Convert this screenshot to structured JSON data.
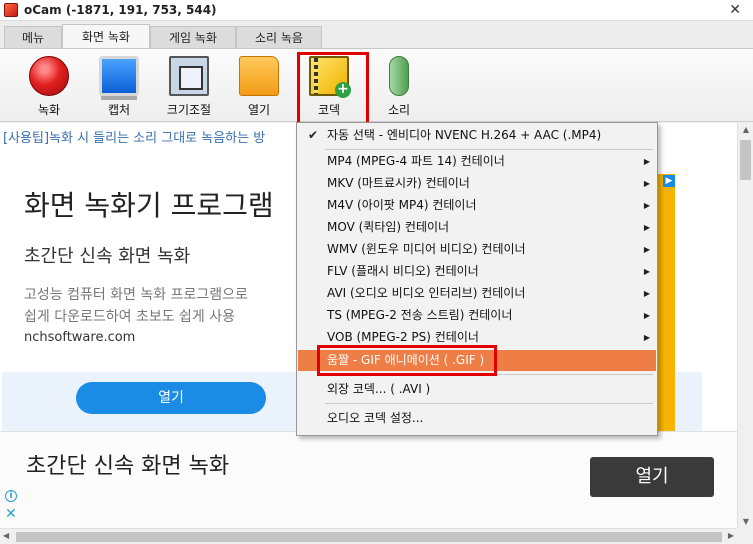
{
  "window": {
    "title": "oCam (-1871, 191, 753, 544)",
    "close_glyph": "✕"
  },
  "tabs": [
    {
      "label": "메뉴"
    },
    {
      "label": "화면 녹화"
    },
    {
      "label": "게임 녹화"
    },
    {
      "label": "소리 녹음"
    }
  ],
  "toolbar": {
    "record": "녹화",
    "capture": "캡처",
    "resize": "크기조절",
    "open": "열기",
    "codec": "코덱",
    "sound": "소리"
  },
  "tip": "[사용팁]녹화 시 들리는 소리 그대로 녹음하는 방",
  "ad": {
    "title": "화면 녹화기 프로그램",
    "subtitle": "초간단 신속 화면 녹화",
    "desc1": "고성능 컴퓨터 화면 녹화 프로그램으로",
    "desc2": "쉽게 다운로드하여 초보도 쉽게 사용",
    "url": "nchsoftware.com",
    "button": "열기",
    "badge": "▶"
  },
  "bottom_ad": {
    "title": "초간단 신속 화면 녹화",
    "button": "열기",
    "info": "i",
    "close": "✕"
  },
  "menu": {
    "auto": "자동 선택 - 엔비디아 NVENC H.264 + AAC (.MP4)",
    "check": "✔",
    "submenu_glyph": "▶",
    "containers": [
      "MP4 (MPEG-4 파트 14) 컨테이너",
      "MKV (마트료시카) 컨테이너",
      "M4V (아이팟 MP4) 컨테이너",
      "MOV (퀵타임) 컨테이너",
      "WMV (윈도우 미디어 비디오) 컨테이너",
      "FLV (플래시 비디오) 컨테이너",
      "AVI (오디오 비디오 인터리브) 컨테이너",
      "TS (MPEG-2 전송 스트림) 컨테이너",
      "VOB (MPEG-2 PS) 컨테이너"
    ],
    "gif": "움짤 - GIF 애니메이션 ( .GIF )",
    "external": "외장 코덱... ( .AVI )",
    "audio": "오디오 코덱 설정..."
  },
  "scroll": {
    "up": "▲",
    "down": "▼",
    "left": "◀",
    "right": "▶"
  },
  "colors": {
    "menu_highlight": "#ef7d46",
    "callout": "#e00000",
    "ad_button": "#1a8ce6"
  }
}
